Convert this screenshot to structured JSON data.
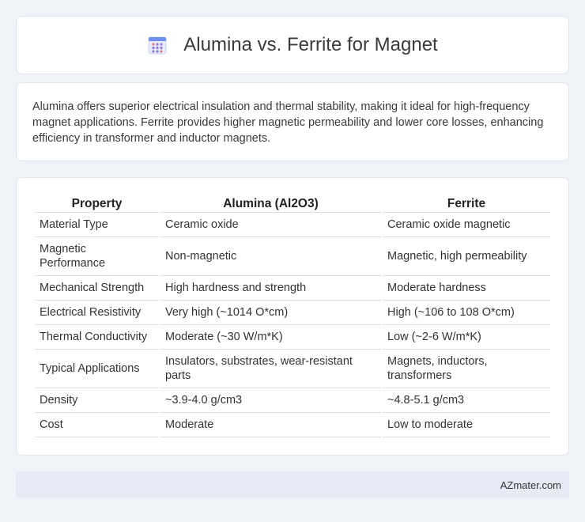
{
  "header": {
    "icon": "calendar-grid-icon",
    "title": "Alumina vs. Ferrite for Magnet"
  },
  "summary": "Alumina offers superior electrical insulation and thermal stability, making it ideal for high-frequency magnet applications. Ferrite provides higher magnetic permeability and lower core losses, enhancing efficiency in transformer and inductor magnets.",
  "table": {
    "headers": [
      "Property",
      "Alumina (Al2O3)",
      "Ferrite"
    ],
    "rows": [
      [
        "Material Type",
        "Ceramic oxide",
        "Ceramic oxide magnetic"
      ],
      [
        "Magnetic Performance",
        "Non-magnetic",
        "Magnetic, high permeability"
      ],
      [
        "Mechanical Strength",
        "High hardness and strength",
        "Moderate hardness"
      ],
      [
        "Electrical Resistivity",
        "Very high (~1014 O*cm)",
        "High (~106 to 108 O*cm)"
      ],
      [
        "Thermal Conductivity",
        "Moderate (~30 W/m*K)",
        "Low (~2-6 W/m*K)"
      ],
      [
        "Typical Applications",
        "Insulators, substrates, wear-resistant parts",
        "Magnets, inductors, transformers"
      ],
      [
        "Density",
        "~3.9-4.0 g/cm3",
        "~4.8-5.1 g/cm3"
      ],
      [
        "Cost",
        "Moderate",
        "Low to moderate"
      ]
    ]
  },
  "footer": {
    "brand": "AZmater.com"
  }
}
